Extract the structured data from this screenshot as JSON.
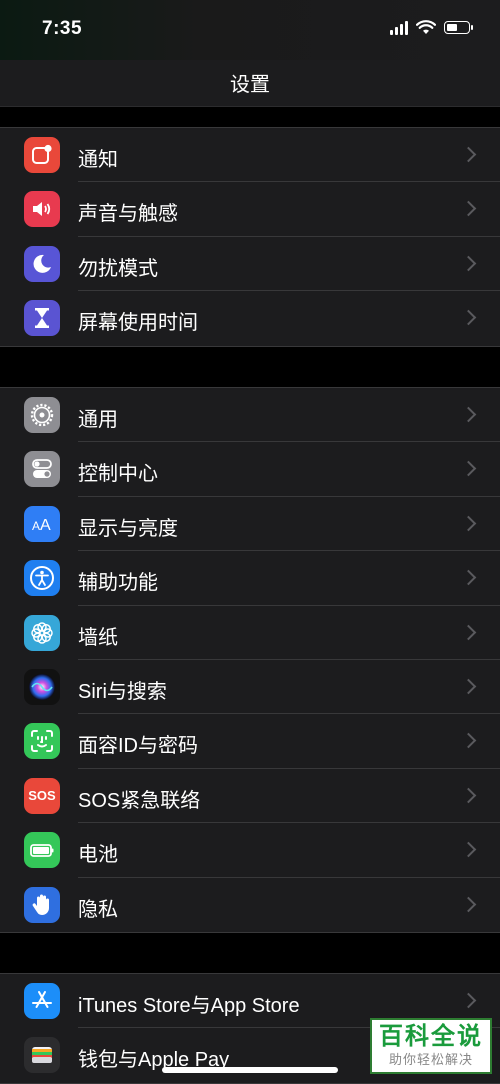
{
  "status_bar": {
    "time": "7:35"
  },
  "header": {
    "title": "设置"
  },
  "groups": [
    {
      "items": [
        {
          "label": "通知",
          "icon": "notifications-icon",
          "color": "#e9483a"
        },
        {
          "label": "声音与触感",
          "icon": "speaker-icon",
          "color": "#e83a4f"
        },
        {
          "label": "勿扰模式",
          "icon": "moon-icon",
          "color": "#5855d6"
        },
        {
          "label": "屏幕使用时间",
          "icon": "hourglass-icon",
          "color": "#5a54d2"
        }
      ]
    },
    {
      "items": [
        {
          "label": "通用",
          "icon": "gear-icon",
          "color": "#8e8e93"
        },
        {
          "label": "控制中心",
          "icon": "toggles-icon",
          "color": "#8e8e93"
        },
        {
          "label": "显示与亮度",
          "icon": "text-size-icon",
          "color": "#2f7ef5"
        },
        {
          "label": "辅助功能",
          "icon": "accessibility-icon",
          "color": "#1f7ff0"
        },
        {
          "label": "墙纸",
          "icon": "flower-icon",
          "color": "#36a7d8"
        },
        {
          "label": "Siri与搜索",
          "icon": "siri-icon",
          "color": "#111111"
        },
        {
          "label": "面容ID与密码",
          "icon": "face-id-icon",
          "color": "#34c759"
        },
        {
          "label": "SOS紧急联络",
          "icon": "sos-icon",
          "color": "#e9483a"
        },
        {
          "label": "电池",
          "icon": "battery-icon",
          "color": "#34c759"
        },
        {
          "label": "隐私",
          "icon": "hand-icon",
          "color": "#2f6fe0"
        }
      ]
    },
    {
      "items": [
        {
          "label": "iTunes Store与App Store",
          "icon": "app-store-icon",
          "color": "#1c8ef9"
        },
        {
          "label": "钱包与Apple Pay",
          "icon": "wallet-icon",
          "color": "#2c2c2e"
        }
      ]
    }
  ],
  "watermark": {
    "title": "百科全说",
    "subtitle": "助你轻松解决"
  }
}
